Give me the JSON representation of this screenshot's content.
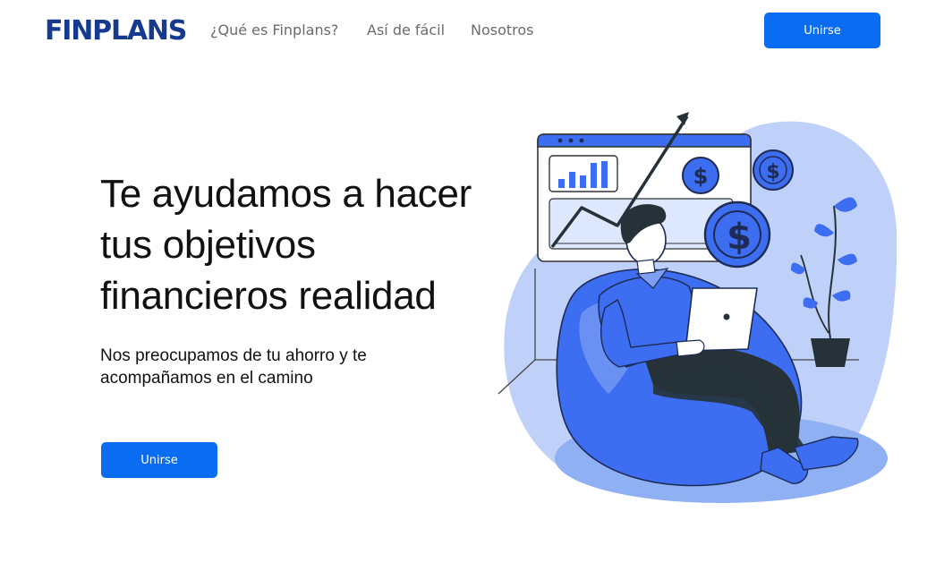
{
  "header": {
    "logo_text": "FINPLANS",
    "nav": [
      {
        "label": "¿Qué es Finplans?"
      },
      {
        "label": "Así de fácil"
      },
      {
        "label": "Nosotros"
      }
    ],
    "join_label": "Unirse"
  },
  "hero": {
    "title_lines": [
      "Te ayudamos a hacer",
      "tus objetivos",
      "financieros realidad"
    ],
    "subtitle_lines": [
      "Nos preocupamos de tu ahorro y te",
      "acompañamos en el camino"
    ],
    "cta_label": "Unirse"
  },
  "illustration": {
    "coin_symbol": "$"
  },
  "colors": {
    "brand": "#163a8e",
    "accent": "#0a6cf0",
    "illustration_blue": "#3d6df0",
    "illustration_light": "#a9c1f6"
  }
}
